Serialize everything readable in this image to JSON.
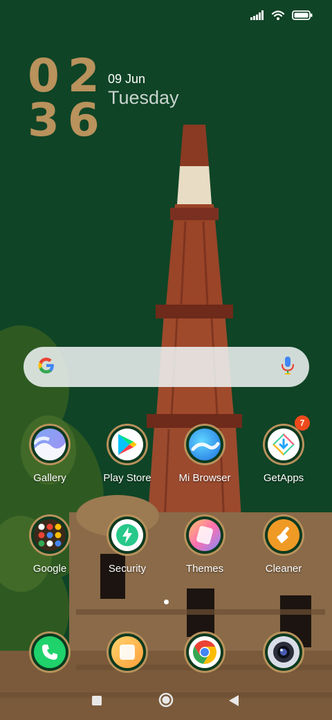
{
  "status": {
    "signal_icon": "cellular-signal-icon",
    "wifi_icon": "wifi-icon",
    "battery_icon": "battery-icon"
  },
  "clock": {
    "hours": "02",
    "minutes": "36",
    "date": "09 Jun",
    "weekday": "Tuesday"
  },
  "search": {
    "logo_icon": "google-g-icon",
    "mic_icon": "microphone-icon"
  },
  "apps": [
    {
      "label": "Gallery",
      "icon": "gallery-icon"
    },
    {
      "label": "Play Store",
      "icon": "play-store-icon"
    },
    {
      "label": "Mi Browser",
      "icon": "mi-browser-icon"
    },
    {
      "label": "GetApps",
      "icon": "getapps-icon",
      "badge": "7"
    },
    {
      "label": "Google",
      "icon": "google-folder-icon"
    },
    {
      "label": "Security",
      "icon": "security-icon"
    },
    {
      "label": "Themes",
      "icon": "themes-icon"
    },
    {
      "label": "Cleaner",
      "icon": "cleaner-icon"
    }
  ],
  "dock": [
    {
      "icon": "phone-icon"
    },
    {
      "icon": "notes-icon"
    },
    {
      "icon": "chrome-icon"
    },
    {
      "icon": "camera-icon"
    }
  ],
  "navigation": {
    "recents_icon": "recents-square-icon",
    "home_icon": "home-circle-icon",
    "back_icon": "back-triangle-icon"
  },
  "colors": {
    "wallpaper_green": "#0f4426",
    "accent_gold": "#b9925c",
    "badge": "#ef4a1c"
  }
}
